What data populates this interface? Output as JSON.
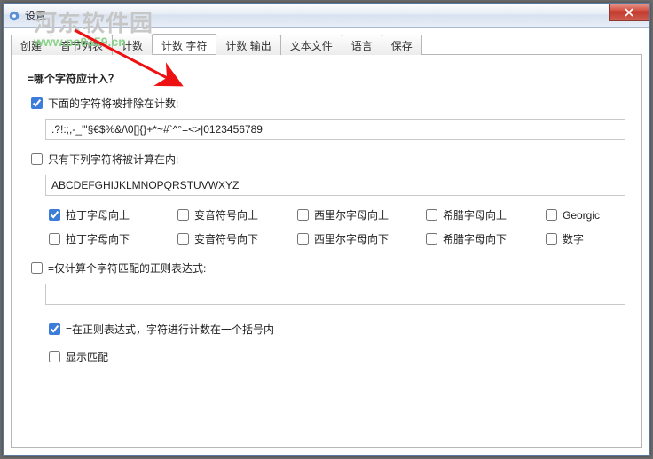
{
  "window": {
    "title": "设置"
  },
  "tabs": [
    "创建",
    "音节列表",
    "计数",
    "计数 字符",
    "计数 输出",
    "文本文件",
    "语言",
    "保存"
  ],
  "active_tab_index": 3,
  "section_heading": "=哪个字符应计入？",
  "exclude": {
    "label": "下面的字符将被排除在计数:",
    "value": ".?!:;,-_'\"§€$%&/\\0[]{}+*~#`^°=<>|0123456789"
  },
  "include": {
    "label": "只有下列字符将被计算在内:",
    "value": "ABCDEFGHIJKLMNOPQRSTUVWXYZ"
  },
  "classes": {
    "latin_up": "拉丁字母向上",
    "diacrit_up": "变音符号向上",
    "cyrillic_up": "西里尔字母向上",
    "greek_up": "希腊字母向上",
    "georgic": "Georgic",
    "latin_dn": "拉丁字母向下",
    "diacrit_dn": "变音符号向下",
    "cyrillic_dn": "西里尔字母向下",
    "greek_dn": "希腊字母向下",
    "digits": "数字"
  },
  "regex_only": {
    "label": "=仅计算个字符匹配的正则表达式:"
  },
  "regex_group": {
    "label": "=在正则表达式，字符进行计数在一个括号内"
  },
  "show_match": {
    "label": "显示匹配"
  },
  "watermark": {
    "name": "河东软件园",
    "url": "www.pc0359.cn"
  }
}
